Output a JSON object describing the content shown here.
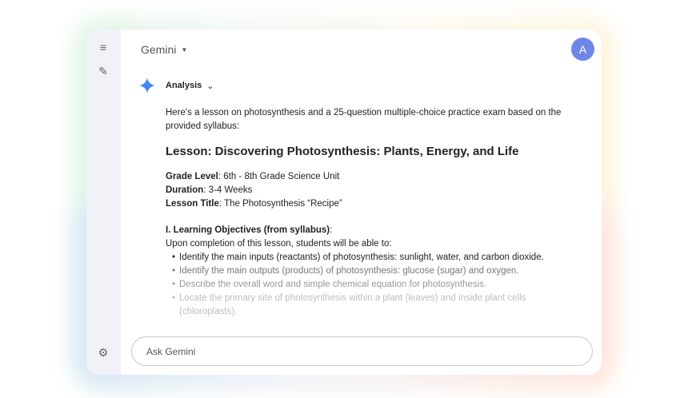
{
  "header": {
    "model": "Gemini",
    "avatar": "A"
  },
  "response": {
    "mode": "Analysis",
    "intro": "Here's a lesson on photosynthesis and a 25-question multiple-choice practice exam based on the provided syllabus:",
    "title": "Lesson: Discovering Photosynthesis: Plants, Energy, and Life",
    "meta": [
      {
        "k": "Grade Level",
        "v": ": 6th - 8th Grade Science Unit"
      },
      {
        "k": "Duration",
        "v": ": 3-4 Weeks"
      },
      {
        "k": "Lesson Title",
        "v": ": The Photosynthesis “Recipe”"
      }
    ],
    "section": "I. Learning Objectives (from syllabus)",
    "section_suffix": ":",
    "section_intro": "Upon completion of this lesson, students will be able to:",
    "objectives": [
      "Identify the main inputs (reactants) of photosynthesis: sunlight, water, and carbon dioxide.",
      "Identify the main outputs (products) of photosynthesis: glucose (sugar) and oxygen.",
      "Describe the overall word and simple chemical equation for photosynthesis.",
      "Locate the primary site of photosynthesis within a plant (leaves) and inside plant cells (chloroplasts)."
    ]
  },
  "input": {
    "placeholder": "Ask Gemini"
  },
  "colors": {
    "avatar": "#6f86e8",
    "sidebar": "#f0f2f7",
    "spark": "#4285f4"
  }
}
